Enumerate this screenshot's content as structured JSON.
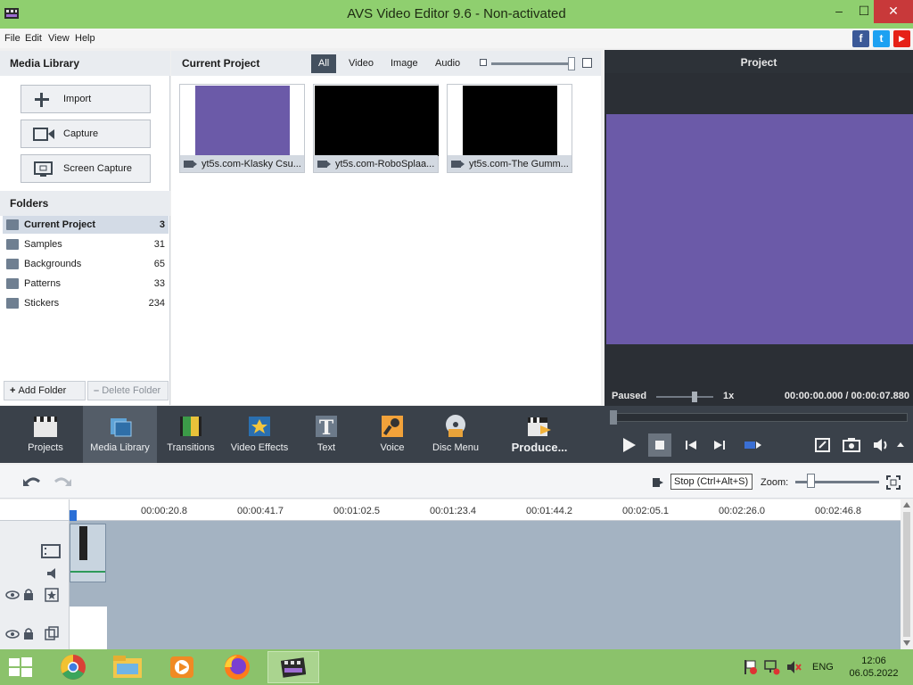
{
  "window": {
    "title": "AVS Video Editor 9.6 - Non-activated",
    "min": "–",
    "max": "☐",
    "close": "✕"
  },
  "menu": [
    "File",
    "Edit",
    "View",
    "Help"
  ],
  "social": {
    "facebook": "f",
    "twitter": "t",
    "youtube": "▶"
  },
  "media_library": {
    "title": "Media Library",
    "buttons": {
      "import": "Import",
      "capture": "Capture",
      "screen_capture": "Screen Capture"
    },
    "folders_title": "Folders",
    "folders": [
      {
        "name": "Current Project",
        "count": "3"
      },
      {
        "name": "Samples",
        "count": "31"
      },
      {
        "name": "Backgrounds",
        "count": "65"
      },
      {
        "name": "Patterns",
        "count": "33"
      },
      {
        "name": "Stickers",
        "count": "234"
      }
    ],
    "add_folder": "Add Folder",
    "delete_folder": "Delete Folder"
  },
  "project": {
    "title": "Current Project",
    "filters": [
      "All",
      "Video",
      "Image",
      "Audio"
    ],
    "items": [
      {
        "name": "yt5s.com-Klasky Csu...",
        "color": "#6b5aa8"
      },
      {
        "name": "yt5s.com-RoboSplaa...",
        "color": "#000000"
      },
      {
        "name": "yt5s.com-The Gumm...",
        "color": "#000000"
      }
    ]
  },
  "preview": {
    "title": "Project",
    "status": "Paused",
    "speed": "1x",
    "current_time": "00:00:00.000",
    "separator": "/",
    "total_time": "00:00:07.880"
  },
  "toolbar": {
    "projects": "Projects",
    "media_library": "Media Library",
    "transitions": "Transitions",
    "video_effects": "Video Effects",
    "text": "Text",
    "voice": "Voice",
    "disc_menu": "Disc Menu",
    "produce": "Produce..."
  },
  "timeline": {
    "tooltip": "Stop (Ctrl+Alt+S)",
    "zoom_label": "Zoom:",
    "ticks": [
      "00:00:20.8",
      "00:00:41.7",
      "00:01:02.5",
      "00:01:23.4",
      "00:01:44.2",
      "00:02:05.1",
      "00:02:26.0",
      "00:02:46.8"
    ]
  },
  "taskbar": {
    "lang": "ENG",
    "time": "12:06",
    "date": "06.05.2022"
  },
  "colors": {
    "titlebar": "#8fcf6f",
    "toolbar": "#3a414a",
    "preview_video": "#6b5aa8",
    "taskbar": "#8bc26b"
  }
}
